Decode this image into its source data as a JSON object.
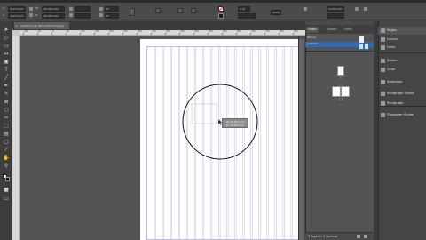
{
  "control": {
    "x_value": "112.5 mm",
    "y_value": "112.5 mm",
    "w_value": "25.453 mm",
    "h_value": "25.453 mm",
    "angle_value": "0°",
    "shear_value": "0°",
    "stroke_weight": "1 pt",
    "zoom": "100%",
    "ref_value": "4.233 mm"
  },
  "document": {
    "tab_title": "Untitled-1 @ 46% [GPU Preview]",
    "close_glyph": "×"
  },
  "ruler": {
    "ticks": [
      "100",
      "50",
      "0",
      "50",
      "100",
      "150",
      "200",
      "250",
      "300",
      "350",
      "400",
      "450",
      "500",
      "550",
      "600",
      "650",
      "700",
      "750",
      "800",
      "850",
      "900"
    ]
  },
  "canvas": {
    "page_fill": "#ffffff",
    "guide_color": "#c9b6e6",
    "circle_stroke": "#111111",
    "column_count": 19
  },
  "tooltip": {
    "line1": "W: 25.453 mm",
    "line2": "H: 25.453 mm"
  },
  "pages_panel": {
    "tabs": [
      "Pages",
      "Layers",
      "Links"
    ],
    "masters": [
      {
        "label": "[None]"
      },
      {
        "label": "A-Master"
      }
    ],
    "page_labels": [
      "1",
      "2-3"
    ],
    "footer": "3 Pages in 2 Spreads"
  },
  "panels": {
    "items": [
      {
        "label": "Pages",
        "selected": true
      },
      {
        "label": "Layers",
        "selected": false
      },
      {
        "label": "Links",
        "selected": false
      },
      {
        "label": "Stroke",
        "selected": false
      },
      {
        "label": "Color",
        "selected": false
      },
      {
        "label": "Swatches",
        "selected": false
      },
      {
        "label": "Paragraph Styles",
        "selected": false
      },
      {
        "label": "Paragraph",
        "selected": false
      },
      {
        "label": "Character Styles",
        "selected": false
      }
    ]
  }
}
